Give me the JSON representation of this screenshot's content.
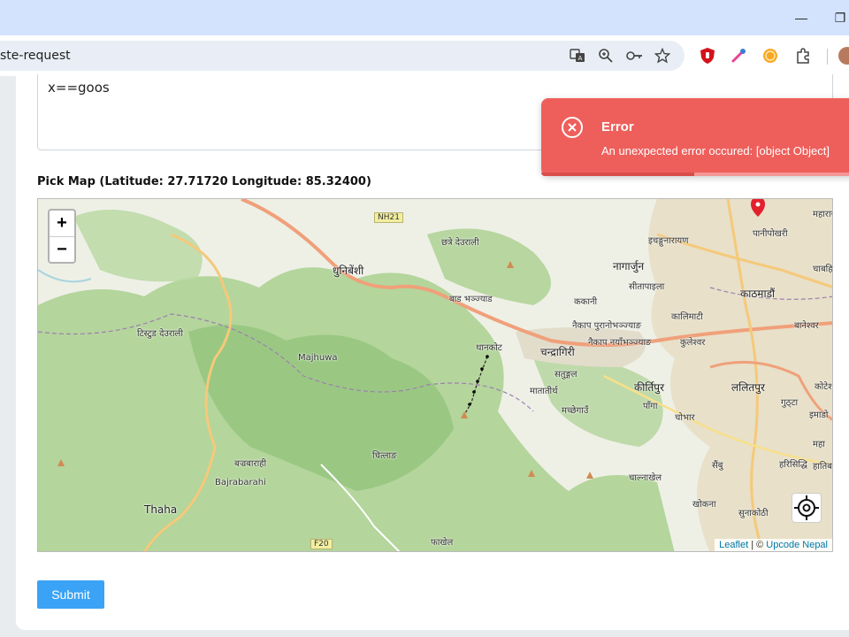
{
  "browser": {
    "url": "ste-request",
    "window_controls": [
      "minimize",
      "restore"
    ],
    "omnibox_icons": [
      "translate-icon",
      "zoom-icon",
      "password-key-icon",
      "bookmark-star-icon"
    ],
    "extension_icons": [
      "ublock-icon",
      "color-picker-icon",
      "orange-extension-icon",
      "extensions-puzzle-icon"
    ]
  },
  "form": {
    "textarea_value": "x==goos",
    "map_label": "Pick Map (Latitude: 27.71720 Longitude: 85.32400)",
    "submit_label": "Submit"
  },
  "map": {
    "zoom_in": "+",
    "zoom_out": "−",
    "attribution_leaflet": "Leaflet",
    "attribution_sep": " | © ",
    "attribution_owner": "Upcode Nepal",
    "place_labels": {
      "nh21": "NH21",
      "chhatre_deurali": "छत्रे देउराली",
      "ichangu": "इचङ्गुनारायण",
      "nagarjun": "नागार्जुन",
      "sitapaila": "सीतापाइला",
      "dhunibeshi": "धुनिबेंशी",
      "badbhanjyang": "बाड भञ्ज्याड",
      "kakani": "ककानी",
      "kathmandu": "काठमाडौं",
      "kalimati": "कालिमाटी",
      "panipokhari": "पानीपोखरी",
      "chabahil": "चाबहि",
      "maharajganj": "महाराज",
      "baneshwor": "बानेश्वर",
      "naikap_old": "नैकाप पुरानोभञ्ज्याङ",
      "naikap_new": "नैकाप नयाँभञ्ज्याङ",
      "kuleshwor": "कुलेश्वर",
      "thankot": "थानकोट",
      "chandragiri": "चन्द्रागिरी",
      "tistung": "टिस्टुड देउराली",
      "majhuwa": "Majhuwa",
      "satungal": "सतुङ्गल",
      "matatirtha": "मातातीर्थ",
      "kirtipur": "कीर्तिपुर",
      "lalitpur": "ललितपुर",
      "koteshwor": "कोटेश",
      "pango": "पाँगा",
      "machchhegaun": "मच्छेगाउँ",
      "chobhar": "चोभार",
      "gudta": "गुठ्टा",
      "imadol": "इमाडो",
      "bajrabarahi_ne": "बज्रबाराही",
      "bajrabarahi": "Bajrabarahi",
      "chitlang": "चित्लाङ",
      "thaha": "Thaha",
      "sainbu": "सैंबु",
      "harisiddhi": "हरिसिद्धि",
      "mahalaxmi": "महा",
      "hatiban": "हातिबन",
      "chalnakhel": "चाल्नाखेल",
      "khokana": "खोकना",
      "sunakothi": "सुनाकोठी",
      "phakhel": "फाखेल",
      "f20": "F20"
    }
  },
  "toast": {
    "title": "Error",
    "message": "An unexpected error occured: [object Object]",
    "progress_fraction": 0.48,
    "color": "#ee5f5b"
  },
  "colors": {
    "submit": "#3aa3f5",
    "forest": "#a9d08e",
    "urban": "#e8e0c8",
    "road_major": "#f0a07a",
    "road_primary": "#f5c97a",
    "marker": "#e3212d"
  }
}
